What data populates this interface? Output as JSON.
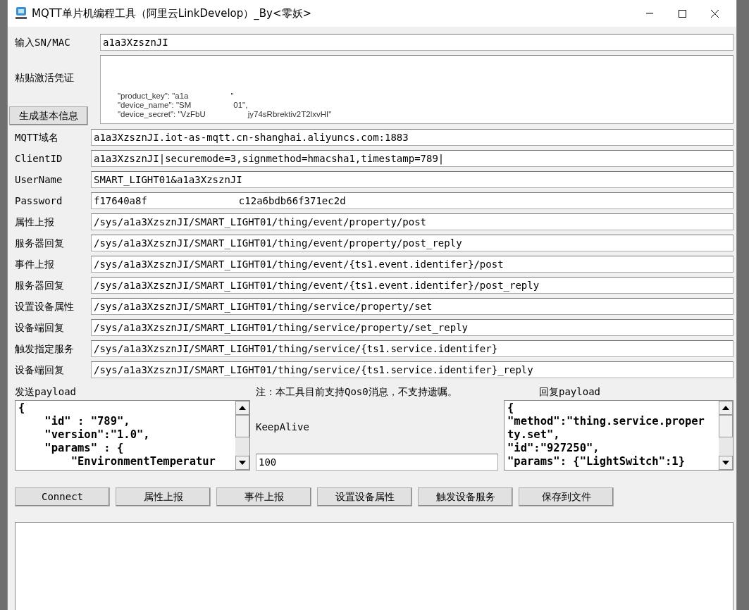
{
  "window": {
    "title": "MQTT单片机编程工具（阿里云LinkDevelop）_By<零妖>"
  },
  "sn": {
    "label": "输入SN/MAC",
    "value": "a1a3XzsznJI"
  },
  "credentials": {
    "label": "粘贴激活凭证",
    "button": "生成基本信息",
    "lines": [
      {
        "parts": [
          "\"product_key\": \"a1a",
          "\""
        ]
      },
      {
        "parts": [
          "\"device_name\": \"SM",
          "01\","
        ]
      },
      {
        "parts": [
          "\"device_secret\": \"VzFbU",
          "jy74sRbrektiv2T2lxvHI\""
        ]
      }
    ]
  },
  "fields": [
    {
      "label": "MQTT域名",
      "parts": [
        "a1a3XzsznJI.iot-as-mqtt.cn-shanghai.aliyuncs.com:1883"
      ]
    },
    {
      "label": "ClientID",
      "parts": [
        "a1a3XzsznJI|securemode=3,signmethod=hmacsha1,timestamp=789|"
      ]
    },
    {
      "label": "UserName",
      "parts": [
        "SMART_LIGHT01&a1a3XzsznJI"
      ]
    },
    {
      "label": "Password",
      "parts": [
        "f17640a8f",
        "c12a6bdb66f371ec2d"
      ]
    },
    {
      "label": "属性上报",
      "parts": [
        "/sys/a1a3XzsznJI/SMART_LIGHT01/thing/event/property/post"
      ]
    },
    {
      "label": "服务器回复",
      "parts": [
        "/sys/a1a3XzsznJI/SMART_LIGHT01/thing/event/property/post_reply"
      ]
    },
    {
      "label": "事件上报",
      "parts": [
        "/sys/a1a3XzsznJI/SMART_LIGHT01/thing/event/{ts1.event.identifer}/post"
      ]
    },
    {
      "label": "服务器回复",
      "parts": [
        "/sys/a1a3XzsznJI/SMART_LIGHT01/thing/event/{ts1.event.identifer}/post_reply"
      ]
    },
    {
      "label": "设置设备属性",
      "parts": [
        "/sys/a1a3XzsznJI/SMART_LIGHT01/thing/service/property/set"
      ]
    },
    {
      "label": "设备端回复",
      "parts": [
        "/sys/a1a3XzsznJI/SMART_LIGHT01/thing/service/property/set_reply"
      ]
    },
    {
      "label": "触发指定服务",
      "parts": [
        "/sys/a1a3XzsznJI/SMART_LIGHT01/thing/service/{ts1.service.identifer}"
      ]
    },
    {
      "label": "设备端回复",
      "parts": [
        "/sys/a1a3XzsznJI/SMART_LIGHT01/thing/service/{ts1.service.identifer}_reply"
      ]
    }
  ],
  "send_payload": {
    "label": "发送payload",
    "lines": [
      "{",
      "    \"id\" : \"789\",",
      "    \"version\":\"1.0\",",
      "    \"params\" : {",
      "        \"EnvironmentTemperatur"
    ]
  },
  "note": "注：本工具目前支持Qos0消息，不支持遗嘱。",
  "keepalive": {
    "label": "KeepAlive",
    "value": "100"
  },
  "reply_payload": {
    "label": "回复payload",
    "lines": [
      "{",
      "\"method\":\"thing.service.proper",
      "ty.set\",",
      "\"id\":\"927250\",",
      "\"params\": {\"LightSwitch\":1}"
    ]
  },
  "buttons": [
    "Connect",
    "属性上报",
    "事件上报",
    "设置设备属性",
    "触发设备服务",
    "保存到文件"
  ]
}
